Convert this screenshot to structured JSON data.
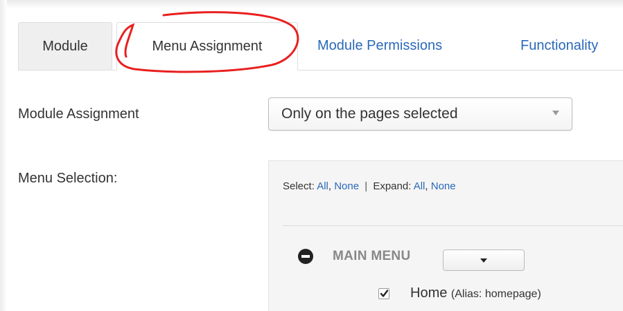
{
  "tabs": [
    {
      "label": "Module",
      "active": false
    },
    {
      "label": "Menu Assignment",
      "active": true
    },
    {
      "label": "Module Permissions",
      "active": false
    },
    {
      "label": "Functionality",
      "active": false
    }
  ],
  "form": {
    "assignment_label": "Module Assignment",
    "assignment_value": "Only on the pages selected",
    "menu_selection_label": "Menu Selection:"
  },
  "panel": {
    "select_label": "Select:",
    "select_all": "All",
    "select_comma": ",",
    "select_none": "None",
    "separator": "|",
    "expand_label": "Expand:",
    "expand_all": "All",
    "expand_comma": ",",
    "expand_none": "None",
    "menu_title": "MAIN MENU",
    "items": [
      {
        "label": "Home",
        "alias": "(Alias: homepage)",
        "checked": true
      }
    ]
  },
  "colors": {
    "link": "#2a69b8",
    "annotation": "#e8201f"
  }
}
